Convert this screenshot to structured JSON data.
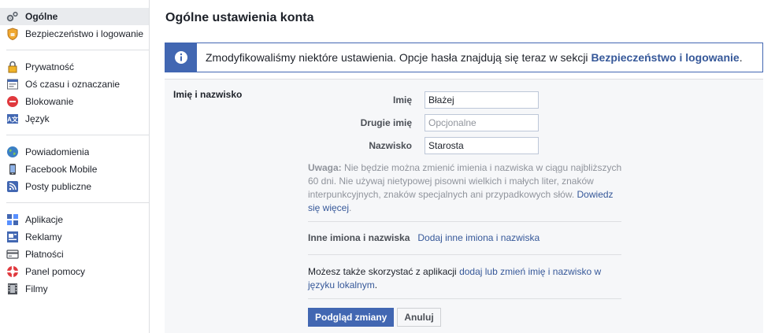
{
  "sidebar": {
    "groups": [
      [
        {
          "label": "Ogólne",
          "icon": "gear-icon",
          "selected": true
        },
        {
          "label": "Bezpieczeństwo i logowanie",
          "icon": "shield-icon"
        }
      ],
      [
        {
          "label": "Prywatność",
          "icon": "lock-icon"
        },
        {
          "label": "Oś czasu i oznaczanie",
          "icon": "timeline-icon"
        },
        {
          "label": "Blokowanie",
          "icon": "block-icon"
        },
        {
          "label": "Język",
          "icon": "language-icon"
        }
      ],
      [
        {
          "label": "Powiadomienia",
          "icon": "globe-icon"
        },
        {
          "label": "Facebook Mobile",
          "icon": "mobile-icon"
        },
        {
          "label": "Posty publiczne",
          "icon": "rss-icon"
        }
      ],
      [
        {
          "label": "Aplikacje",
          "icon": "apps-icon"
        },
        {
          "label": "Reklamy",
          "icon": "ads-icon"
        },
        {
          "label": "Płatności",
          "icon": "card-icon"
        },
        {
          "label": "Panel pomocy",
          "icon": "lifebuoy-icon"
        },
        {
          "label": "Filmy",
          "icon": "film-icon"
        }
      ]
    ]
  },
  "main": {
    "title": "Ogólne ustawienia konta",
    "info": {
      "text": "Zmodyfikowaliśmy niektóre ustawienia. Opcje hasła znajdują się teraz w sekcji ",
      "link": "Bezpieczeństwo i logowanie",
      "suffix": "."
    },
    "section_label": "Imię i nazwisko",
    "fields": {
      "first_name": {
        "label": "Imię",
        "value": "Błażej"
      },
      "middle_name": {
        "label": "Drugie imię",
        "placeholder": "Opcjonalne",
        "value": ""
      },
      "last_name": {
        "label": "Nazwisko",
        "value": "Starosta"
      }
    },
    "note": {
      "bold": "Uwaga:",
      "text": " Nie będzie można zmienić imienia i nazwiska w ciągu najbliższych 60 dni. Nie używaj nietypowej pisowni wielkich i małych liter, znaków interpunkcyjnych, znaków specjalnych ani przypadkowych słów. ",
      "link": "Dowiedz się więcej",
      "suffix": "."
    },
    "other_names": {
      "label": "Inne imiona i nazwiska",
      "link": "Dodaj inne imiona i nazwiska"
    },
    "local": {
      "text": "Możesz także skorzystać z aplikacji ",
      "link": "dodaj lub zmień imię i nazwisko w języku lokalnym",
      "suffix": "."
    },
    "buttons": {
      "preview": "Podgląd zmiany",
      "cancel": "Anuluj"
    }
  },
  "colors": {
    "accent": "#4267b2",
    "link": "#365899",
    "panel_bg": "#f6f7f9",
    "selected_bg": "#e9ebee"
  }
}
